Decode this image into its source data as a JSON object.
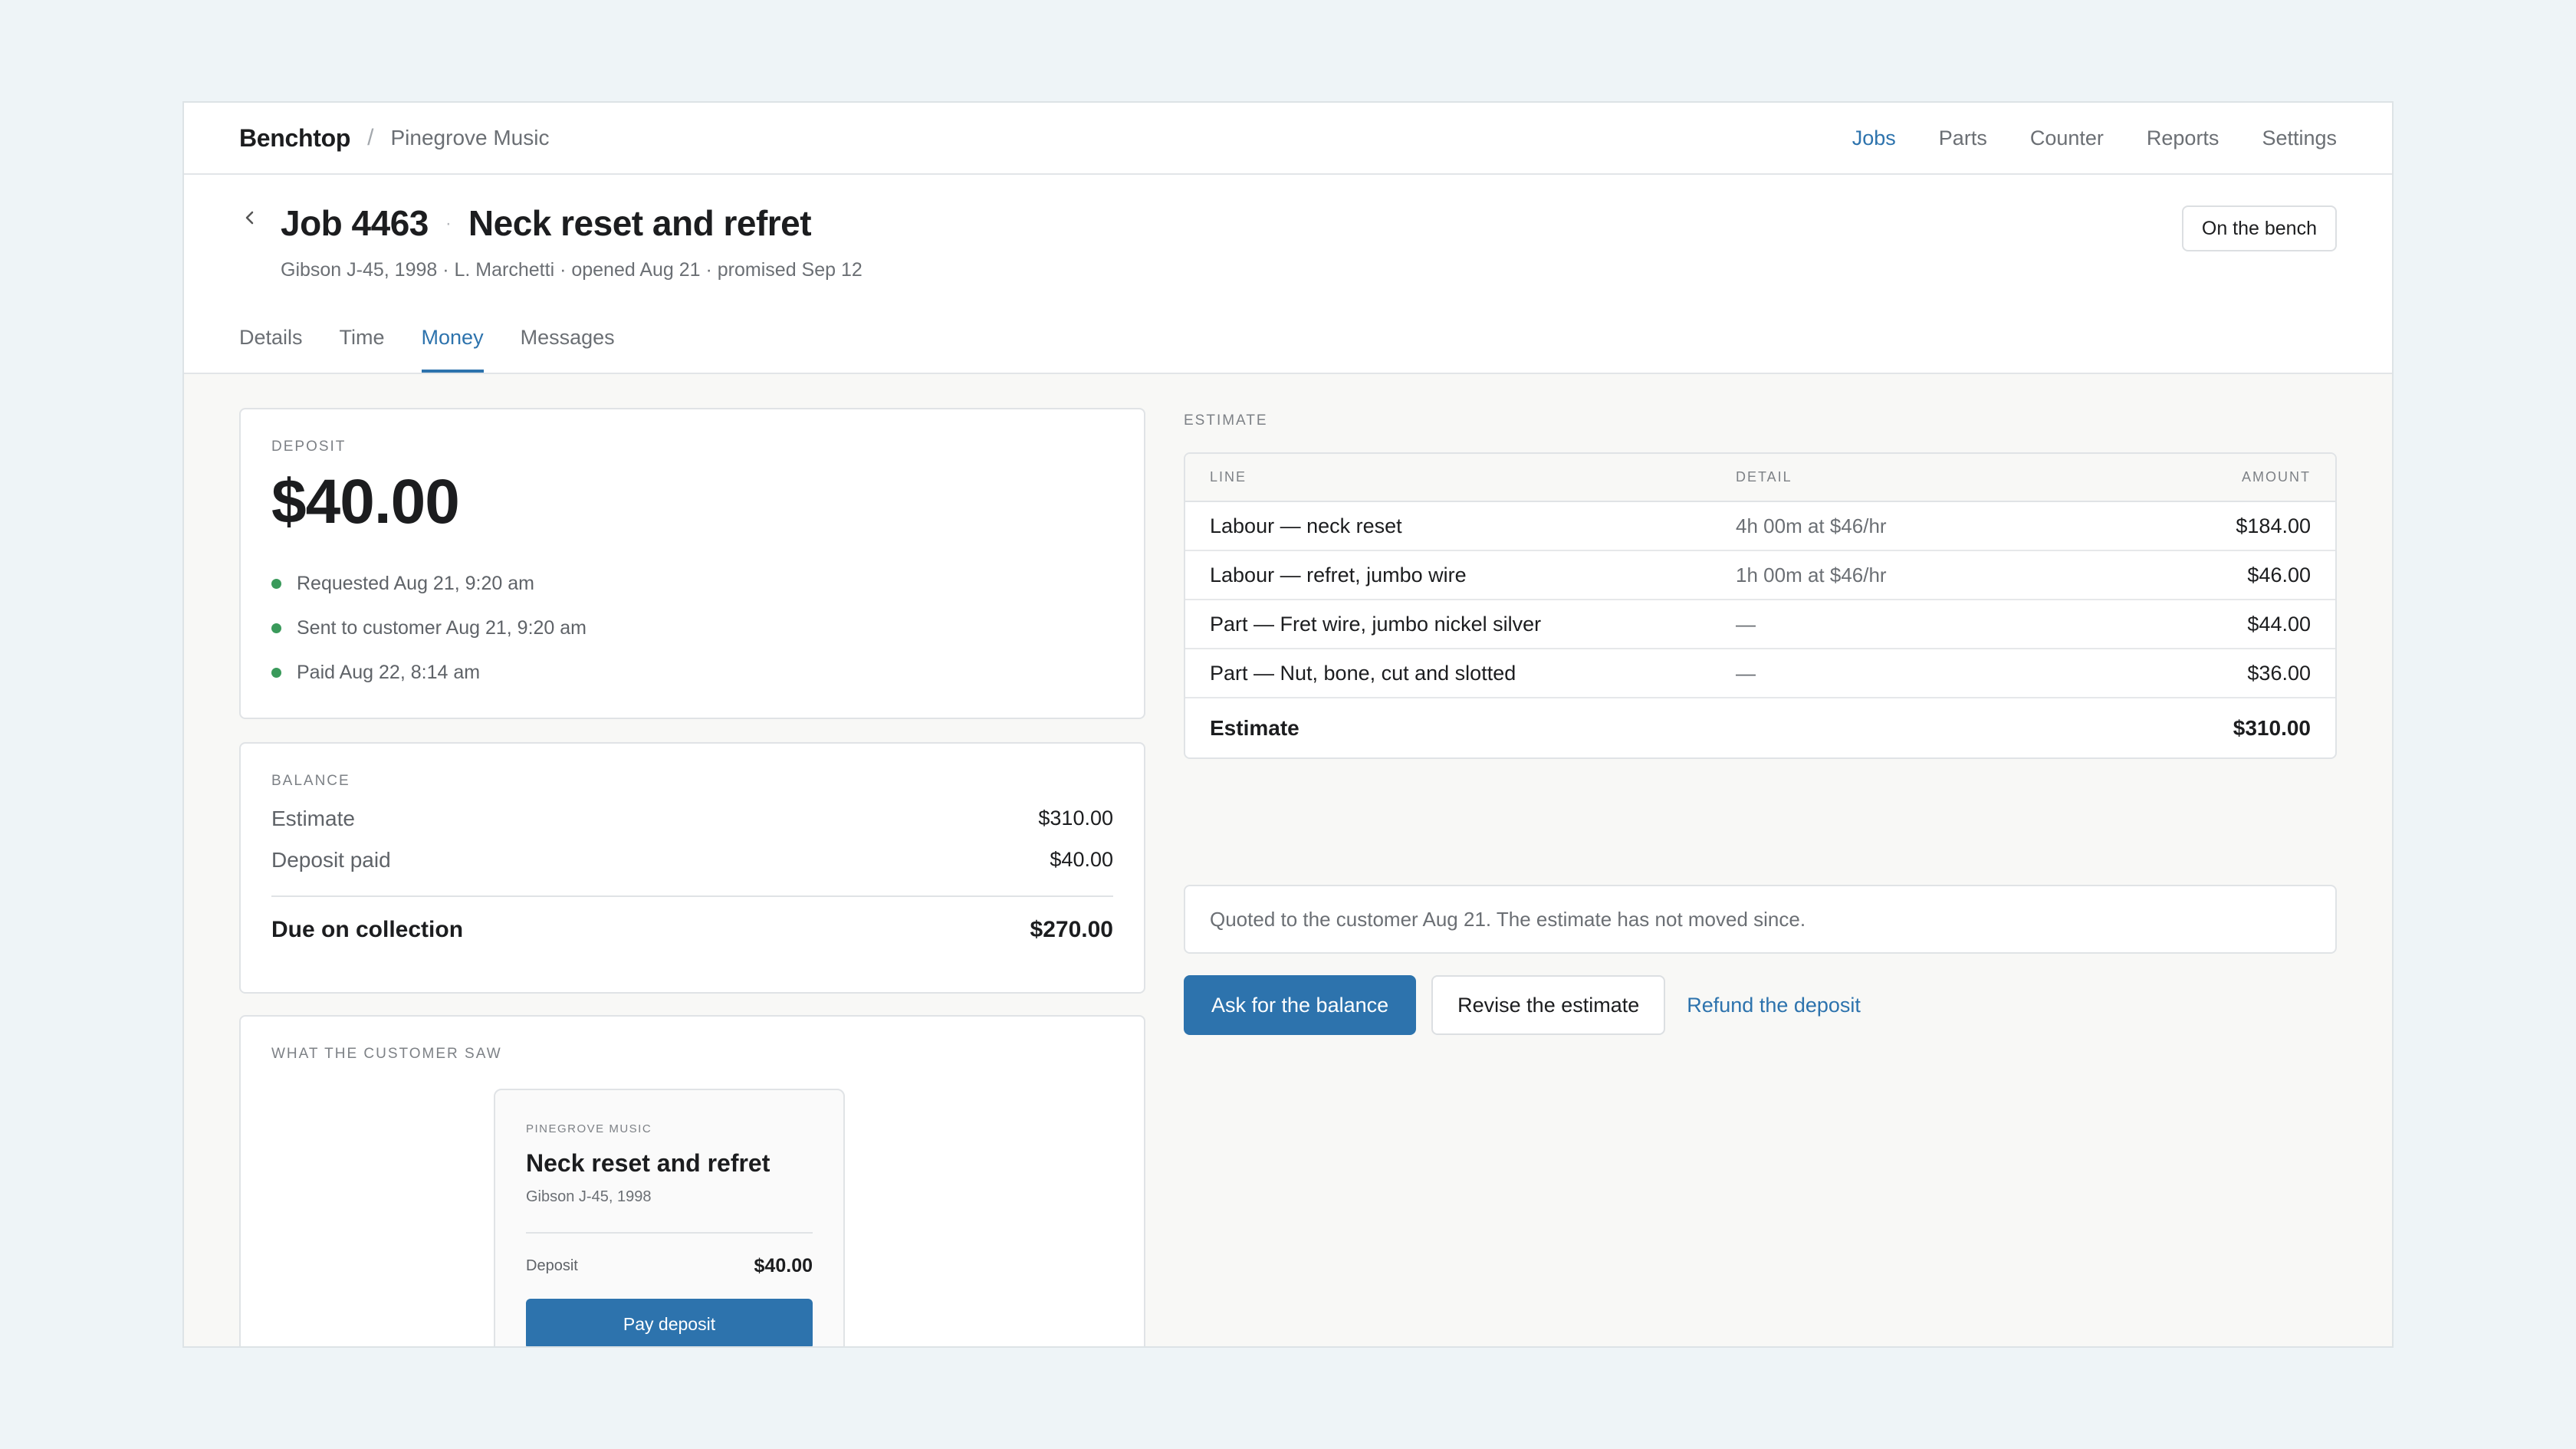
{
  "topbar": {
    "brand": "Benchtop",
    "separator": "/",
    "shop": "Pinegrove Music",
    "nav": [
      "Jobs",
      "Parts",
      "Counter",
      "Reports",
      "Settings"
    ]
  },
  "header": {
    "back_icon": "chevron-left-icon",
    "job_number": "Job 4463",
    "dot": "·",
    "job_title": "Neck reset and refret",
    "subtitle": "Gibson J-45, 1998 · L. Marchetti · opened Aug 21 · promised Sep 12",
    "status": "On the bench",
    "tabs": [
      "Details",
      "Time",
      "Money",
      "Messages"
    ],
    "active_tab": "Money"
  },
  "deposit": {
    "label": "Deposit",
    "amount": "$40.00",
    "events": [
      "Requested Aug 21, 9:20 am",
      "Sent to customer Aug 21, 9:20 am",
      "Paid Aug 22, 8:14 am"
    ],
    "event_color": "#3a9a5b"
  },
  "balance": {
    "label": "Balance",
    "estimate_label": "Estimate",
    "estimate_value": "$310.00",
    "deposit_label": "Deposit paid",
    "deposit_value": "$40.00",
    "due_label": "Due on collection",
    "due_value": "$270.00"
  },
  "customer_view": {
    "label": "What the customer saw",
    "shop": "Pinegrove Music",
    "title": "Neck reset and refret",
    "instrument": "Gibson J-45, 1998",
    "deposit_label": "Deposit",
    "deposit_value": "$40.00",
    "pay_button": "Pay deposit"
  },
  "estimate": {
    "label": "Estimate",
    "columns": [
      "Line",
      "Detail",
      "Amount"
    ],
    "rows": [
      {
        "line": "Labour — neck reset",
        "detail": "4h 00m at $46/hr",
        "amount": "$184.00"
      },
      {
        "line": "Labour — refret, jumbo wire",
        "detail": "1h 00m at $46/hr",
        "amount": "$46.00"
      },
      {
        "line": "Part — Fret wire, jumbo nickel silver",
        "detail": "—",
        "amount": "$44.00"
      },
      {
        "line": "Part — Nut, bone, cut and slotted",
        "detail": "—",
        "amount": "$36.00"
      }
    ],
    "total_label": "Estimate",
    "total_value": "$310.00",
    "note": "Quoted to the customer Aug 21. The estimate has not moved since."
  },
  "actions": {
    "primary": "Ask for the balance",
    "secondary": "Revise the estimate",
    "link": "Refund the deposit"
  },
  "colors": {
    "accent": "#2d73ad",
    "background": "#eef4f7",
    "success": "#3a9a5b"
  }
}
